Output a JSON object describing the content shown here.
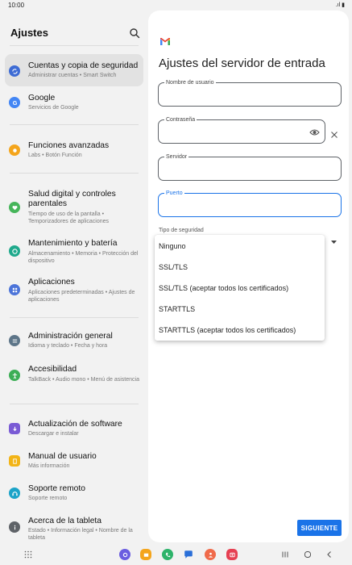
{
  "status": {
    "time": "10:00",
    "icons": ".ıl ▮"
  },
  "left": {
    "title": "Ajustes",
    "items": [
      {
        "title": "Cuentas y copia de seguridad",
        "subtitle": "Administrar cuentas • Smart Switch",
        "icon": "sync-icon",
        "color": "#3d6bd4"
      },
      {
        "title": "Google",
        "subtitle": "Servicios de Google",
        "icon": "google-icon",
        "color": "#4285f4"
      },
      {
        "title": "Funciones avanzadas",
        "subtitle": "Labs • Botón Función",
        "icon": "advanced-features-icon",
        "color": "#f4a51c"
      },
      {
        "title": "Salud digital y controles parentales",
        "subtitle": "Tiempo de uso de la pantalla • Temporizadores de aplicaciones",
        "icon": "digital-wellbeing-icon",
        "color": "#46b55a"
      },
      {
        "title": "Mantenimiento y batería",
        "subtitle": "Almacenamiento • Memoria • Protección del dispositivo",
        "icon": "device-care-icon",
        "color": "#1fa98c"
      },
      {
        "title": "Aplicaciones",
        "subtitle": "Aplicaciones predeterminadas • Ajustes de aplicaciones",
        "icon": "apps-icon",
        "color": "#4c74d9"
      },
      {
        "title": "Administración general",
        "subtitle": "Idioma y teclado • Fecha y hora",
        "icon": "general-management-icon",
        "color": "#5d7588"
      },
      {
        "title": "Accesibilidad",
        "subtitle": "TalkBack • Audio mono • Menú de asistencia",
        "icon": "accessibility-icon",
        "color": "#3cae55"
      },
      {
        "title": "Actualización de software",
        "subtitle": "Descargar e instalar",
        "icon": "software-update-icon",
        "color": "#7a5bd5"
      },
      {
        "title": "Manual de usuario",
        "subtitle": "Más información",
        "icon": "user-manual-icon",
        "color": "#f2b417"
      },
      {
        "title": "Soporte remoto",
        "subtitle": "Soporte remoto",
        "icon": "remote-support-icon",
        "color": "#1ba3c8"
      },
      {
        "title": "Acerca de la tableta",
        "subtitle": "Estado • Información legal • Nombre de la tableta",
        "icon": "about-tablet-icon",
        "color": "#5f6368"
      }
    ]
  },
  "right": {
    "title": "Ajustes del servidor de entrada",
    "fields": {
      "username_label": "Nombre de usuario",
      "username_value": "",
      "password_label": "Contraseña",
      "password_value": "",
      "server_label": "Servidor",
      "server_value": "",
      "port_label": "Puerto",
      "port_value": ""
    },
    "security_label": "Tipo de seguridad",
    "security_options": [
      "Ninguno",
      "SSL/TLS",
      "SSL/TLS (aceptar todos los certificados)",
      "STARTTLS",
      "STARTTLS (aceptar todos los certificados)"
    ],
    "next_label": "SIGUIENTE"
  },
  "dock": [
    "bixby-icon",
    "my-files-icon",
    "phone-icon",
    "messages-icon",
    "contacts-icon",
    "screen-recorder-icon"
  ]
}
